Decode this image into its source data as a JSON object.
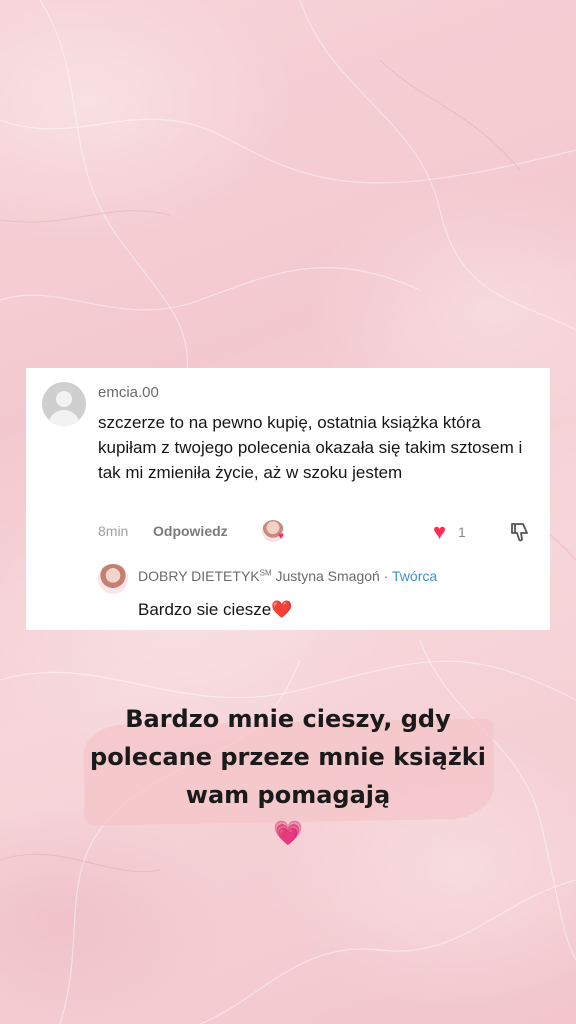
{
  "comment": {
    "username": "emcia.00",
    "text": "szczerze to na pewno kupię, ostatnia książka która kupiłam z twojego polecenia okazała się takim sztosem i tak mi zmieniła życie, aż w szoku jestem",
    "time": "8min",
    "reply_label": "Odpowiedz",
    "like_count": "1",
    "icons": [
      "default-avatar-icon",
      "creator-liked-icon",
      "heart-icon",
      "dislike-icon"
    ]
  },
  "reply": {
    "author": "DOBRY DIETETYK",
    "author_sup": "SM",
    "author_name": "Justyna Smagoń",
    "separator": " · ",
    "badge": "Twórca",
    "text": "Bardzo sie ciesze",
    "emoji": "❤️"
  },
  "caption": {
    "line1": "Bardzo mnie cieszy, gdy",
    "line2": "polecane przeze mnie książki",
    "line3": "wam pomagają",
    "emoji": "💗"
  },
  "colors": {
    "background": "#f4cdd3",
    "like": "#fe2c55",
    "creator_badge": "#3b94c4",
    "brush": "#f4c4c8"
  }
}
